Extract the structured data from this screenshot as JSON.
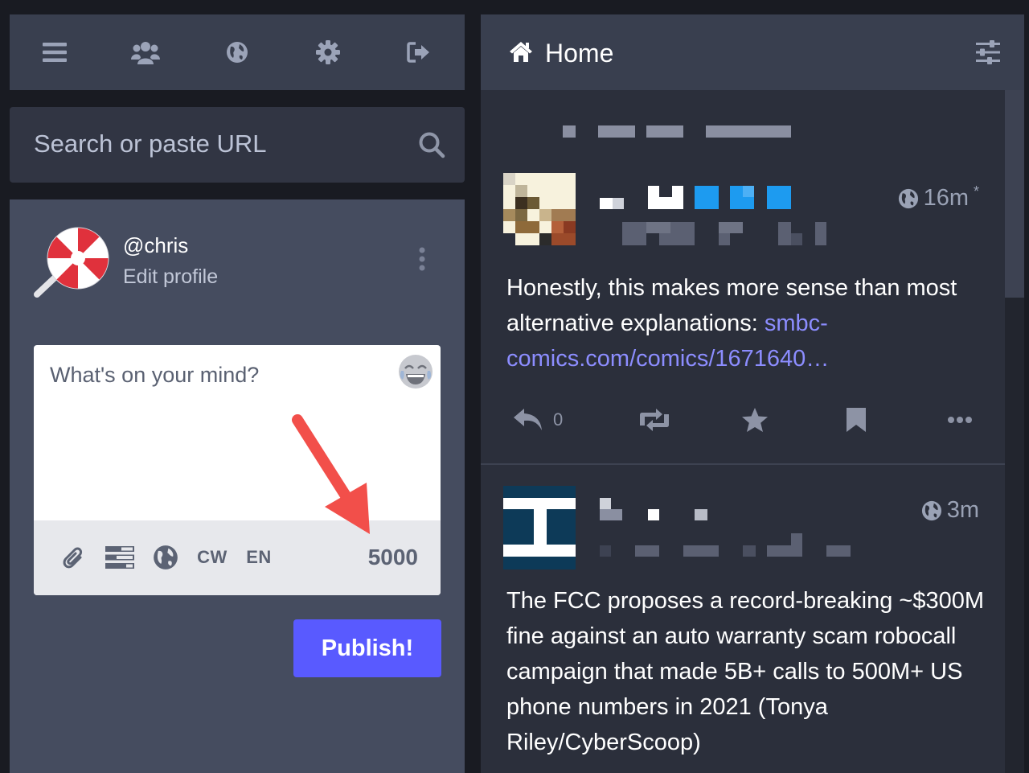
{
  "nav": {
    "icons": [
      "menu-icon",
      "people-icon",
      "globe-icon",
      "gear-icon",
      "logout-icon"
    ]
  },
  "search": {
    "placeholder": "Search or paste URL"
  },
  "profile": {
    "handle": "@chris",
    "edit_label": "Edit profile"
  },
  "composer": {
    "placeholder": "What's on your mind?",
    "tools": [
      "CW",
      "EN"
    ],
    "char_count": "5000",
    "publish_label": "Publish!"
  },
  "column": {
    "title": "Home"
  },
  "statuses": [
    {
      "time": "16m",
      "time_suffix": "*",
      "text": "Honestly, this makes more sense than most alternative explanations: ",
      "link": "smbc-comics.com/comics/1671640…",
      "reply_count": "0"
    },
    {
      "time": "3m",
      "text": "The FCC proposes a record-breaking ~$300M fine against an auto warranty scam robocall campaign that made 5B+ calls to 500M+ US phone numbers in 2021 (Tonya Riley/CyberScoop)"
    }
  ],
  "colors": {
    "accent": "#595aff",
    "link": "#8c8dff",
    "panel": "#454c5f",
    "header": "#393f4f"
  }
}
